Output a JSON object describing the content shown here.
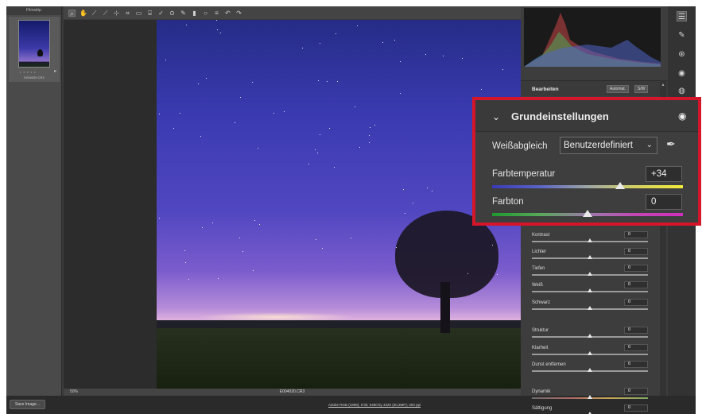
{
  "filmstrip": {
    "title": "Filmstrip",
    "item": {
      "filename": "E004020.CR3",
      "rating_dots": "• • • • •",
      "badge": "e"
    }
  },
  "toolbar": {
    "tools": [
      "zoom-icon",
      "hand-icon",
      "white-balance-icon",
      "color-sampler-icon",
      "target-adjust-icon",
      "crop-icon",
      "straighten-icon",
      "transform-icon",
      "spot-removal-icon",
      "redeye-icon",
      "brush-icon",
      "graduated-filter-icon",
      "radial-filter-icon",
      "preferences-icon",
      "rotate-left-icon",
      "rotate-right-icon"
    ]
  },
  "canvas": {
    "zoom": "50%",
    "filename": "E004020.CR3"
  },
  "bottom": {
    "save_label": "Save Image...",
    "workflow_info": "Adobe RGB (1998); 8 bit; 6480 by 4320 (30,3MP); 300 ppi"
  },
  "panel": {
    "title": "Bearbeiten",
    "auto_label": "Automat.",
    "bw_label": "S/W",
    "sliders": [
      {
        "label": "Kontrast",
        "value": "0",
        "pos": 0.5,
        "track": "gray"
      },
      {
        "label": "Lichter",
        "value": "0",
        "pos": 0.5,
        "track": "gray"
      },
      {
        "label": "Tiefen",
        "value": "0",
        "pos": 0.5,
        "track": "gray"
      },
      {
        "label": "Weiß",
        "value": "0",
        "pos": 0.5,
        "track": "gray"
      },
      {
        "label": "Schwarz",
        "value": "0",
        "pos": 0.5,
        "track": "gray"
      },
      {
        "label": "Struktur",
        "value": "0",
        "pos": 0.5,
        "track": "gray"
      },
      {
        "label": "Klarheit",
        "value": "0",
        "pos": 0.5,
        "track": "gray"
      },
      {
        "label": "Dunst entfernen",
        "value": "0",
        "pos": 0.5,
        "track": "gray"
      },
      {
        "label": "Dynamik",
        "value": "0",
        "pos": 0.5,
        "track": "dynamik"
      },
      {
        "label": "Sättigung",
        "value": "0",
        "pos": 0.5,
        "track": "saett"
      }
    ]
  },
  "icons": [
    "edit-sliders-icon",
    "brush-icon",
    "crop-icon",
    "redeye-icon",
    "presets-icon"
  ],
  "callout": {
    "title": "Grundeinstellungen",
    "wb_label": "Weißabgleich",
    "wb_value": "Benutzerdefiniert",
    "temp_label": "Farbtemperatur",
    "temp_value": "+34",
    "temp_pos": 0.67,
    "tint_label": "Farbton",
    "tint_value": "0",
    "tint_pos": 0.5
  },
  "colors": {
    "accent_frame": "#d5152a"
  }
}
